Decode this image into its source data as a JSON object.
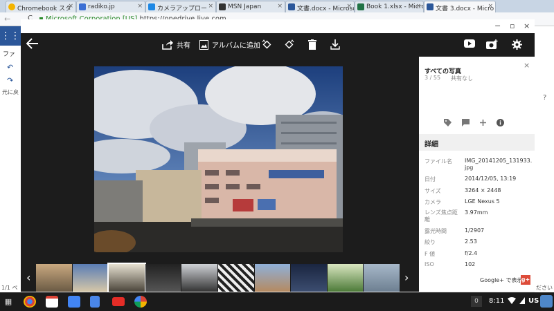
{
  "browser": {
    "tabs": [
      {
        "title": "Chromebook スタ",
        "fav": "#f4b400"
      },
      {
        "title": "radiko.jp",
        "fav": "#3b6fd4"
      },
      {
        "title": "カメラアップロー",
        "fav": "#1e88e5"
      },
      {
        "title": "MSN Japan",
        "fav": "#333333"
      },
      {
        "title": "文書.docx - Microso",
        "fav": "#2b579a"
      },
      {
        "title": "Book 1.xlsx - Micro",
        "fav": "#217346"
      },
      {
        "title": "文書 3.docx - Micro",
        "fav": "#2b579a"
      }
    ],
    "url_org": "Microsoft Corporation [US]",
    "url_text": "https://onedrive.live.com"
  },
  "background": {
    "file_tab": "ファ",
    "undo_label": "元に戻",
    "page_indicator": "1/1 ペ",
    "right_edge": "ださい",
    "help": "?"
  },
  "toolbar": {
    "share_label": "共有",
    "add_to_album_label": "アルバムに追加"
  },
  "panel": {
    "title": "すべての写真",
    "count": "3 / 55",
    "share_status": "共有なし",
    "details_header": "詳細",
    "details": [
      {
        "key": "ファイル名",
        "value": "IMG_20141205_131933.jpg"
      },
      {
        "key": "日付",
        "value": "2014/12/05, 13:19"
      },
      {
        "key": "サイズ",
        "value": "3264 × 2448"
      },
      {
        "key": "カメラ",
        "value": "LGE Nexus 5"
      },
      {
        "key": "レンズ焦点距離",
        "value": "3.97mm"
      },
      {
        "key": "露光時間",
        "value": "1/2907"
      },
      {
        "key": "絞り",
        "value": "2.53"
      },
      {
        "key": "F 値",
        "value": "f/2.4"
      },
      {
        "key": "ISO",
        "value": "102"
      }
    ],
    "google_plus_label": "Google+ で表示",
    "google_plus_badge": "g+"
  },
  "shelf": {
    "notification_count": "0",
    "time": "8:11",
    "locale": "US"
  },
  "icons": {
    "back": "back-arrow-icon",
    "share": "share-icon",
    "album": "photo-album-icon",
    "rotate_left": "rotate-left-icon",
    "rotate_right": "rotate-right-icon",
    "delete": "trash-icon",
    "download": "download-icon",
    "video": "youtube-icon",
    "camera": "camera-add-icon",
    "settings": "gear-icon"
  },
  "colors": {
    "viewer_bg": "#1c1c1c",
    "word_blue": "#2b579a",
    "google_red": "#dd4b39"
  }
}
